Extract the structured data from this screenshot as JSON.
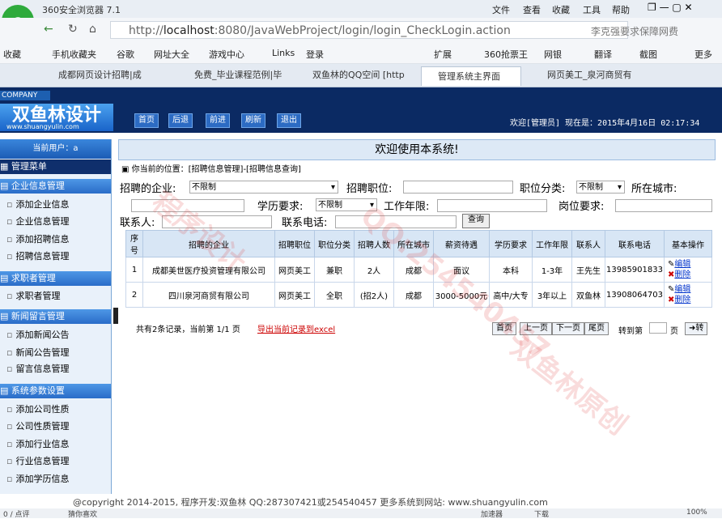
{
  "browser": {
    "title": "360安全浏览器 7.1",
    "menu": [
      "文件",
      "查看",
      "收藏",
      "工具",
      "帮助"
    ],
    "url_prefix": "http://",
    "url_host": "localhost",
    "url_rest": ":8080/JavaWebProject/login/login_CheckLogin.action",
    "search_hint": "李克强要求保障网费",
    "favorites": [
      "收藏",
      "手机收藏夹",
      "谷歌",
      "网址大全",
      "游戏中心",
      "Links",
      "登录",
      "扩展",
      "360抢票王",
      "网银",
      "翻译",
      "截图",
      "更多"
    ],
    "tabs": [
      "成都网页设计招聘|成",
      "免费_毕业课程范例|毕",
      "双鱼林的QQ空间 [http",
      "管理系统主界面",
      "网页美工_泉河商贸有"
    ],
    "active_tab": 3,
    "status_left": "0 / 点评",
    "status_mid": "猜你喜欢",
    "status_right": [
      "加速器",
      "下载",
      "100%"
    ]
  },
  "app": {
    "company": "COMPANY",
    "brand": "双鱼林设计",
    "brand_url": "www.shuangyulin.com",
    "nav": [
      "首页",
      "后退",
      "前进",
      "刷新",
      "退出"
    ],
    "welcome": "欢迎[管理员]  现在是：2015年4月16日 02:17:34",
    "current_user": "当前用户：a",
    "admin_menu": "管理菜单",
    "main_title": "欢迎使用本系统!",
    "footer": "@copyright 2014-2015, 程序开发:双鱼林  QQ:287307421或254540457  更多系统到网站: www.shuangyulin.com"
  },
  "sidebar": {
    "groups": [
      {
        "title": "企业信息管理",
        "items": [
          "添加企业信息",
          "企业信息管理",
          "添加招聘信息",
          "招聘信息管理"
        ]
      },
      {
        "title": "求职者管理",
        "items": [
          "求职者管理"
        ]
      },
      {
        "title": "新闻留言管理",
        "items": [
          "添加新闻公告",
          "新闻公告管理",
          "留言信息管理"
        ]
      },
      {
        "title": "系统参数设置",
        "items": [
          "添加公司性质",
          "公司性质管理",
          "添加行业信息",
          "行业信息管理",
          "添加学历信息"
        ]
      }
    ]
  },
  "page": {
    "breadcrumb": "你当前的位置：[招聘信息管理]-[招聘信息查询]",
    "filters": {
      "company_label": "招聘的企业:",
      "company_value": "不限制",
      "position_label": "招聘职位:",
      "category_label": "职位分类:",
      "category_value": "不限制",
      "city_label": "所在城市:",
      "edu_label": "学历要求:",
      "edu_value": "不限制",
      "years_label": "工作年限:",
      "req_label": "岗位要求:",
      "contact_label": "联系人:",
      "phone_label": "联系电话:",
      "query_btn": "查询"
    },
    "table": {
      "headers": [
        "序号",
        "招聘的企业",
        "招聘职位",
        "职位分类",
        "招聘人数",
        "所在城市",
        "薪资待遇",
        "学历要求",
        "工作年限",
        "联系人",
        "联系电话",
        "基本操作"
      ],
      "rows": [
        [
          "1",
          "成都美世医疗投资管理有限公司",
          "网页美工",
          "兼职",
          "2人",
          "成都",
          "面议",
          "本科",
          "1-3年",
          "王先生",
          "13985901833"
        ],
        [
          "2",
          "四川泉河商贸有限公司",
          "网页美工",
          "全职",
          "(招2人)",
          "成都",
          "3000-5000元",
          "高中/大专",
          "3年以上",
          "双鱼林",
          "13908064703"
        ]
      ],
      "edit_label": "编辑",
      "delete_label": "删除"
    },
    "pager": {
      "summary": "共有2条记录，当前第 1/1 页",
      "export": "导出当前记录到excel",
      "buttons": [
        "首页",
        "上一页",
        "下一页",
        "尾页"
      ],
      "goto": "转到第",
      "page_unit": "页",
      "go": "转"
    }
  },
  "colors": {
    "header": "#0b2a63",
    "accent": "#2a6cc8",
    "sidebar": "#e9f1fa"
  }
}
